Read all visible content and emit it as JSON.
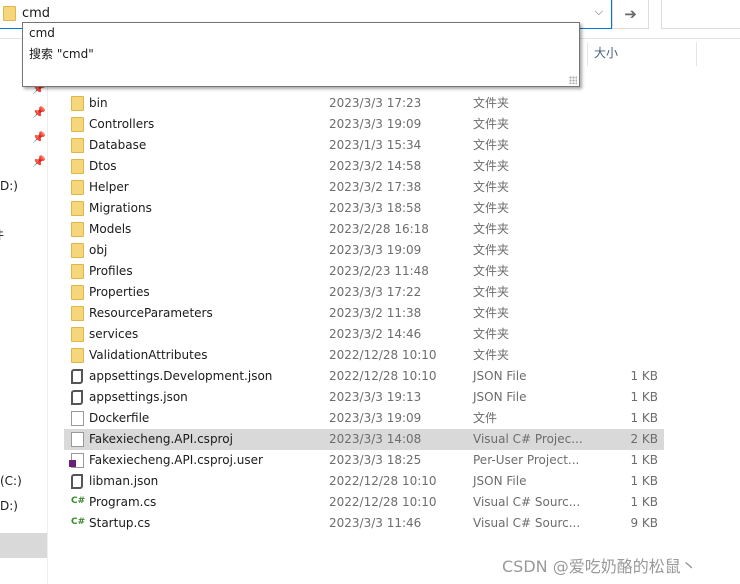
{
  "address_bar": {
    "value": "cmd",
    "go_icon": "arrow-right-icon",
    "dropdown_icon": "chevron-down-icon"
  },
  "autocomplete": {
    "items": [
      "cmd",
      "搜索 \"cmd\""
    ]
  },
  "nav_pane": {
    "items": [
      {
        "label": "D:)"
      },
      {
        "label": "件"
      },
      {
        "label": "(C:)"
      },
      {
        "label": "D:)",
        "selected": true
      }
    ]
  },
  "columns": {
    "size": "大小"
  },
  "files": [
    {
      "name": "bin",
      "date": "2023/3/3 17:23",
      "type": "文件夹",
      "size": "",
      "icon": "folder"
    },
    {
      "name": "Controllers",
      "date": "2023/3/3 19:09",
      "type": "文件夹",
      "size": "",
      "icon": "folder"
    },
    {
      "name": "Database",
      "date": "2023/1/3 15:34",
      "type": "文件夹",
      "size": "",
      "icon": "folder"
    },
    {
      "name": "Dtos",
      "date": "2023/3/2 14:58",
      "type": "文件夹",
      "size": "",
      "icon": "folder"
    },
    {
      "name": "Helper",
      "date": "2023/3/2 17:38",
      "type": "文件夹",
      "size": "",
      "icon": "folder"
    },
    {
      "name": "Migrations",
      "date": "2023/3/3 18:58",
      "type": "文件夹",
      "size": "",
      "icon": "folder"
    },
    {
      "name": "Models",
      "date": "2023/2/28 16:18",
      "type": "文件夹",
      "size": "",
      "icon": "folder"
    },
    {
      "name": "obj",
      "date": "2023/3/3 19:09",
      "type": "文件夹",
      "size": "",
      "icon": "folder"
    },
    {
      "name": "Profiles",
      "date": "2023/2/23 11:48",
      "type": "文件夹",
      "size": "",
      "icon": "folder"
    },
    {
      "name": "Properties",
      "date": "2023/3/3 17:22",
      "type": "文件夹",
      "size": "",
      "icon": "folder"
    },
    {
      "name": "ResourceParameters",
      "date": "2023/3/2 11:38",
      "type": "文件夹",
      "size": "",
      "icon": "folder"
    },
    {
      "name": "services",
      "date": "2023/3/2 14:46",
      "type": "文件夹",
      "size": "",
      "icon": "folder"
    },
    {
      "name": "ValidationAttributes",
      "date": "2022/12/28 10:10",
      "type": "文件夹",
      "size": "",
      "icon": "folder"
    },
    {
      "name": "appsettings.Development.json",
      "date": "2022/12/28 10:10",
      "type": "JSON File",
      "size": "1 KB",
      "icon": "json"
    },
    {
      "name": "appsettings.json",
      "date": "2023/3/3 19:13",
      "type": "JSON File",
      "size": "1 KB",
      "icon": "json"
    },
    {
      "name": "Dockerfile",
      "date": "2023/3/3 19:09",
      "type": "文件",
      "size": "1 KB",
      "icon": "file"
    },
    {
      "name": "Fakexiecheng.API.csproj",
      "date": "2023/3/3 14:08",
      "type": "Visual C# Projec...",
      "size": "2 KB",
      "icon": "file",
      "selected": true
    },
    {
      "name": "Fakexiecheng.API.csproj.user",
      "date": "2023/3/3 18:25",
      "type": "Per-User Project...",
      "size": "1 KB",
      "icon": "user"
    },
    {
      "name": "libman.json",
      "date": "2022/12/28 10:10",
      "type": "JSON File",
      "size": "1 KB",
      "icon": "json"
    },
    {
      "name": "Program.cs",
      "date": "2022/12/28 10:10",
      "type": "Visual C# Sourc...",
      "size": "1 KB",
      "icon": "cs"
    },
    {
      "name": "Startup.cs",
      "date": "2023/3/3 11:46",
      "type": "Visual C# Sourc...",
      "size": "9 KB",
      "icon": "cs"
    }
  ],
  "watermark": "CSDN @爱吃奶酪的松鼠丶"
}
